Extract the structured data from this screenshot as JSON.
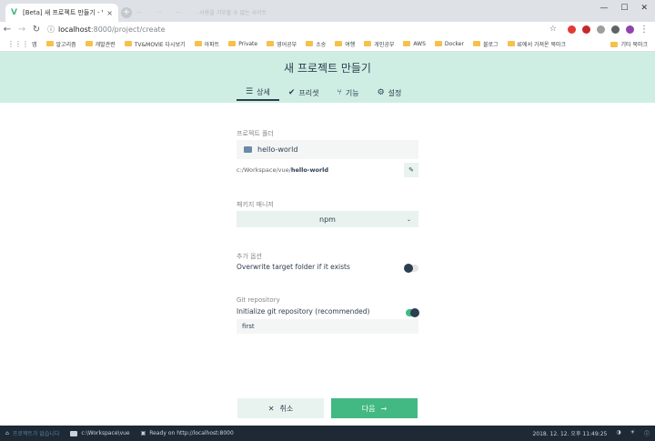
{
  "browser": {
    "tab_title": "[Beta] 새 프로젝트 만들기 - Vue",
    "tab_close": "×",
    "new_tab": "+",
    "ghost_tabs": [
      "...",
      "...",
      "...",
      "- 사용을 거부할 수 없는 사이트"
    ],
    "window_controls": [
      "—",
      "☐",
      "✕"
    ],
    "url_host": "localhost",
    "url_path": ":8000/project/create",
    "back": "←",
    "forward": "→",
    "reload": "↻",
    "lock": "ⓘ",
    "star": "☆",
    "menu": "⋮"
  },
  "bookmarks": {
    "apps_label": "앱",
    "items": [
      "알고리즘",
      "개발관련",
      "TV&MOVIE 다시보기",
      "아파트",
      "Private",
      "영어공부",
      "소송",
      "여행",
      "개인공부",
      "AWS",
      "Docker",
      "블로그",
      "IE에서 가져온 북마크"
    ],
    "other": "기타 북마크"
  },
  "header": {
    "title": "새 프로젝트 만들기",
    "tabs": [
      {
        "label": "상세",
        "icon": "☰"
      },
      {
        "label": "프리셋",
        "icon": "✔"
      },
      {
        "label": "기능",
        "icon": "⑂"
      },
      {
        "label": "설정",
        "icon": "⚙"
      }
    ]
  },
  "form": {
    "folder_label": "프로젝트 폴더",
    "folder_value": "hello-world",
    "path_prefix": "c:/Workspace/vue/",
    "path_name": "hello-world",
    "edit_icon": "✎",
    "pm_label": "패키지 매니저",
    "pm_value": "npm",
    "pm_caret": "⌄",
    "options_label": "추가 옵션",
    "overwrite_label": "Overwrite target folder if it exists",
    "overwrite_on": false,
    "git_label": "Git repository",
    "git_init_label": "Initialize git repository (recommended)",
    "git_init_on": true,
    "git_message": "first"
  },
  "footer": {
    "cancel_label": "취소",
    "cancel_icon": "✕",
    "next_label": "다음",
    "next_icon": "→"
  },
  "statusbar": {
    "message": "프로젝트가 없습니다",
    "folder": "c:\\Workspace\\vue",
    "ready": "Ready on http://localhost:8000",
    "date": "2018. 12. 12. 오후 11:49:25"
  },
  "colors": {
    "accent": "#42b983",
    "header_bg": "#cfeee3",
    "dark": "#2c3e50",
    "statusbar": "#1d2935"
  }
}
